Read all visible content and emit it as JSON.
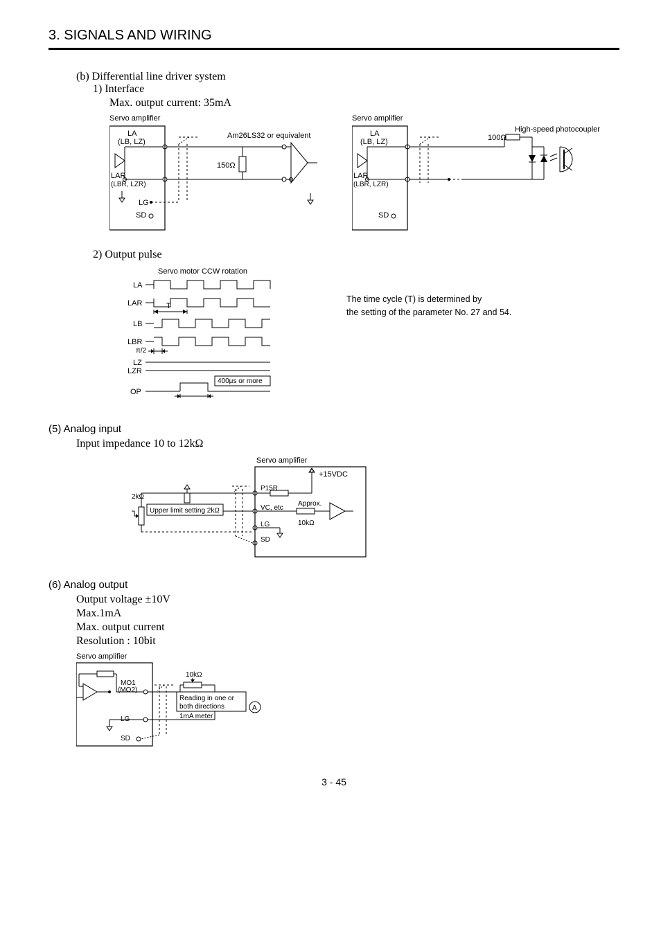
{
  "chapter": "3. SIGNALS AND WIRING",
  "sec_b": "(b) Differential line driver system",
  "sec_b1": "1) Interface",
  "max_out": "Max. output current: 35mA",
  "servo_amp": "Servo amplifier",
  "la_lblz": "LA\n(LB, LZ)",
  "lar_lbrlzr": "LAR\n(LBR, LZR)",
  "lg": "LG",
  "sd": "SD",
  "am26": "Am26LS32 or equivalent",
  "r150": "150Ω",
  "r100": "100Ω",
  "hspc": "High-speed photocoupler",
  "sec_b2": "2) Output pulse",
  "ccw": "Servo motor CCW rotation",
  "LA": "LA",
  "LAR": "LAR",
  "LB": "LB",
  "LBR": "LBR",
  "LZ": "LZ",
  "LZR": "LZR",
  "OP": "OP",
  "T": "T",
  "pi2": "π/2",
  "us400": "400μs or more",
  "time_desc1": "The time cycle (T) is determined by",
  "time_desc2": "the setting of the parameter No. 27 and 54.",
  "sec5": "(5) Analog input",
  "imp": "Input impedance 10 to 12kΩ",
  "p15r": "P15R",
  "vc_etc": "VC, etc",
  "lg2": "LG",
  "sd2": "SD",
  "vdc15": "+15VDC",
  "approx10k": "Approx.\n10kΩ",
  "k2": "2kΩ",
  "upper_limit": "Upper limit setting 2kΩ",
  "sec6": "(6) Analog output",
  "out_v": "Output voltage ±10V",
  "max1ma": "Max.1mA",
  "max_oc": "Max. output current",
  "res10": "Resolution : 10bit",
  "mo12": "MO1\n(MO2)",
  "k10": "10kΩ",
  "reading": "Reading in one or\nboth directions",
  "meter": "1mA meter",
  "circA": "A",
  "page": "3 -  45"
}
